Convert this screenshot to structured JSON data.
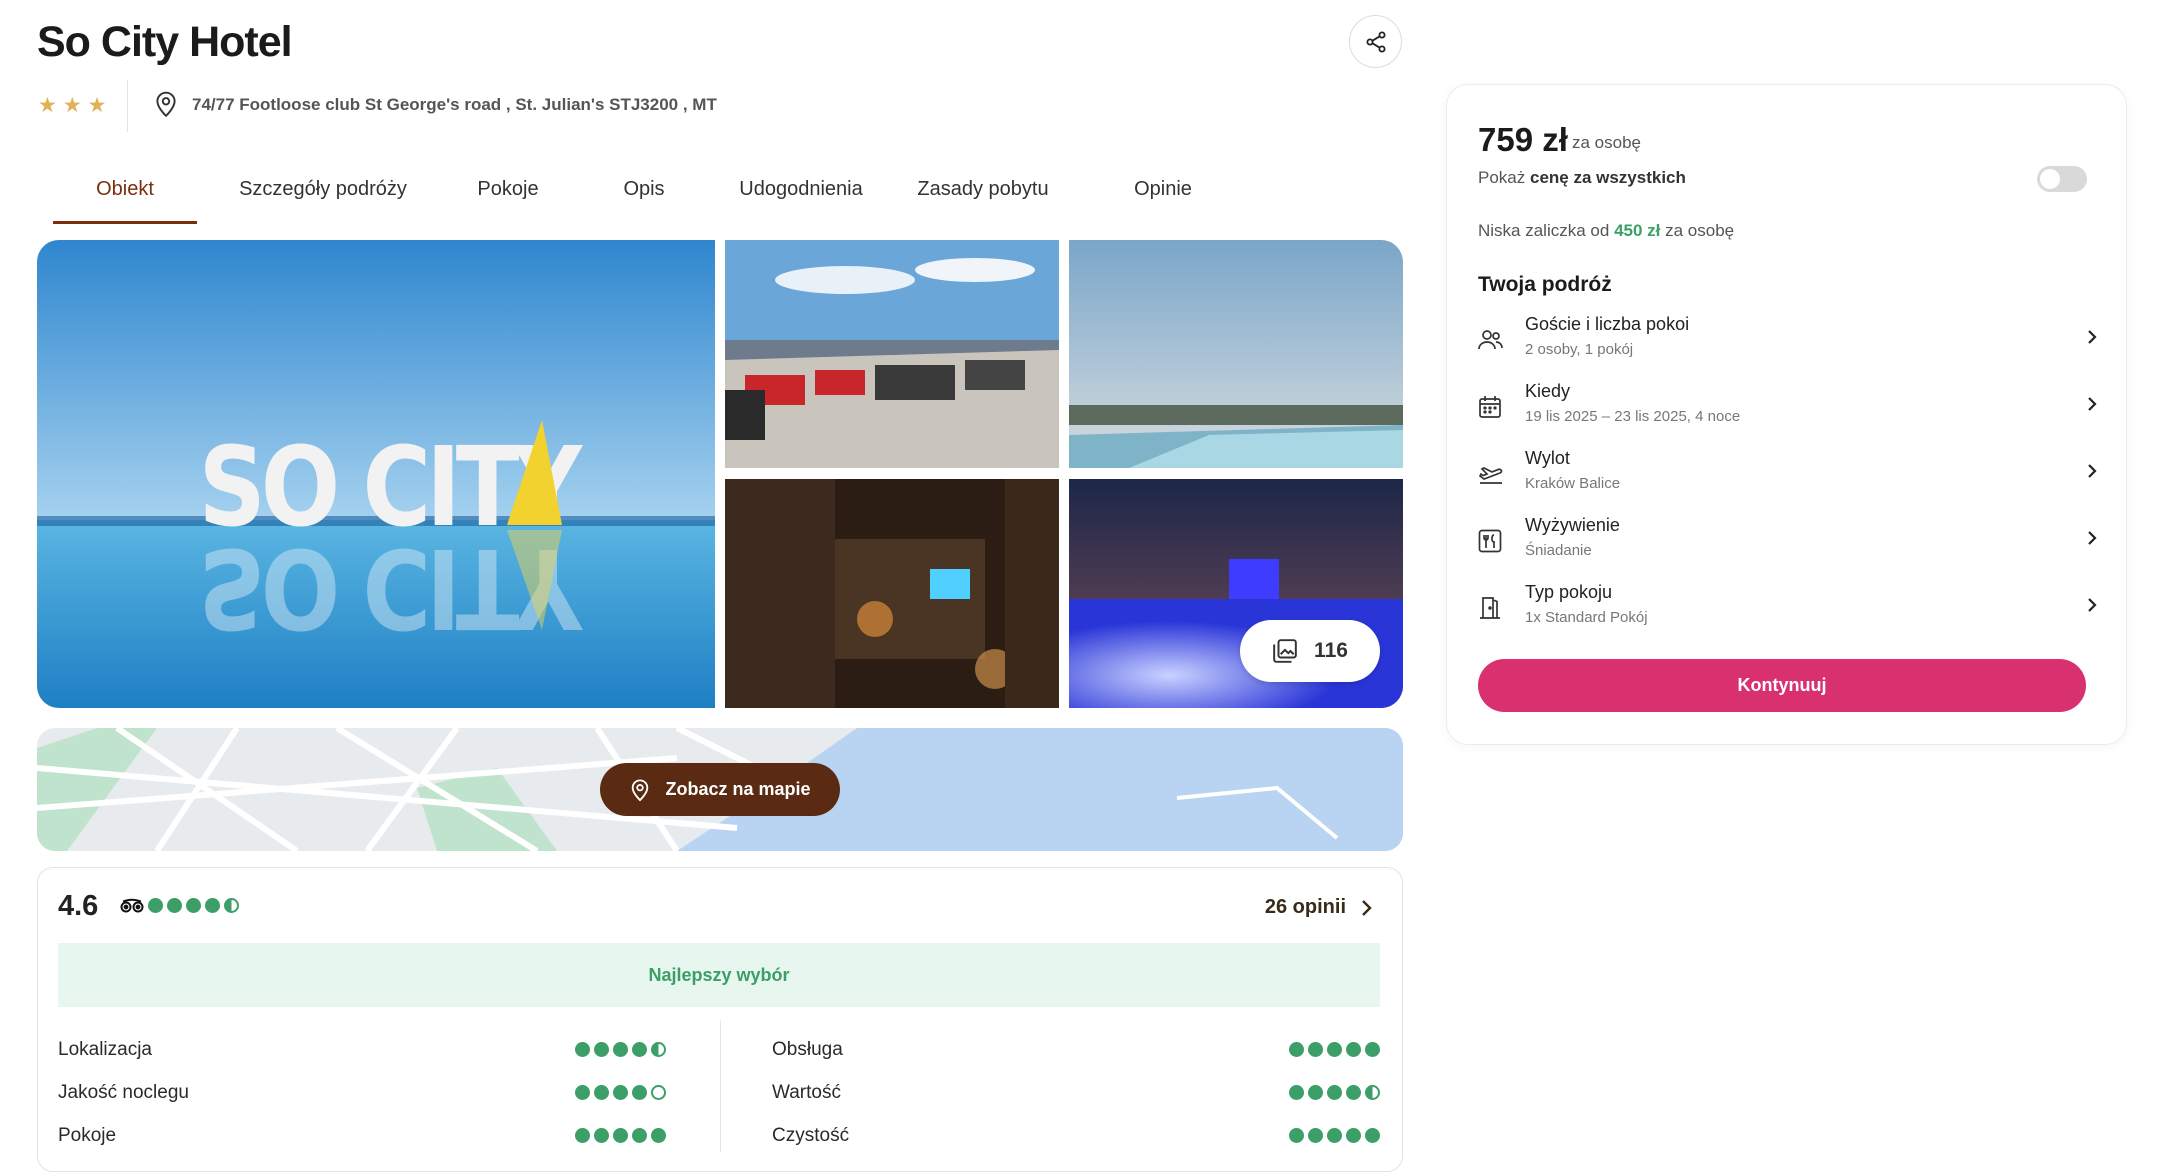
{
  "hotel": {
    "name": "So City Hotel",
    "stars": 3,
    "address": "74/77 Footloose club St George's road , St. Julian's STJ3200 , MT"
  },
  "icons": {
    "share": "share-icon",
    "location": "map-pin-icon",
    "gallery": "gallery-icon",
    "tripadvisor": "tripadvisor-icon",
    "chevron": "chevron-right-icon"
  },
  "tabs": [
    {
      "label": "Obiekt",
      "active": true
    },
    {
      "label": "Szczegóły podróży",
      "active": false
    },
    {
      "label": "Pokoje",
      "active": false
    },
    {
      "label": "Opis",
      "active": false
    },
    {
      "label": "Udogodnienia",
      "active": false
    },
    {
      "label": "Zasady pobytu",
      "active": false
    },
    {
      "label": "Opinie",
      "active": false
    }
  ],
  "gallery": {
    "photo_count": "116"
  },
  "map": {
    "button_label": "Zobacz na mapie"
  },
  "reviews": {
    "score": "4.6",
    "score_dots": 4.5,
    "opinions_label": "26 opinii",
    "badge": "Najlepszy wybór",
    "categories_left": [
      {
        "label": "Lokalizacja",
        "rating": 4.5
      },
      {
        "label": "Jakość noclegu",
        "rating": 4
      },
      {
        "label": "Pokoje",
        "rating": 5
      }
    ],
    "categories_right": [
      {
        "label": "Obsługa",
        "rating": 5
      },
      {
        "label": "Wartość",
        "rating": 4.5
      },
      {
        "label": "Czystość",
        "rating": 5
      }
    ]
  },
  "booking": {
    "price": "759 zł",
    "per_person": "za osobę",
    "show_all_prefix": "Pokaż",
    "show_all_bold": "cenę za wszystkich",
    "deposit_prefix": "Niska zaliczka od",
    "deposit_amount": "450 zł",
    "deposit_suffix": "za osobę",
    "trip_title": "Twoja podróż",
    "trip_rows": [
      {
        "icon": "guests-icon",
        "label": "Goście i liczba pokoi",
        "value": "2 osoby, 1 pokój"
      },
      {
        "icon": "calendar-icon",
        "label": "Kiedy",
        "value": "19 lis 2025 – 23 lis 2025, 4 noce"
      },
      {
        "icon": "plane-departure-icon",
        "label": "Wylot",
        "value": "Kraków Balice"
      },
      {
        "icon": "meal-icon",
        "label": "Wyżywienie",
        "value": "Śniadanie"
      },
      {
        "icon": "door-icon",
        "label": "Typ pokoju",
        "value": "1x Standard Pokój"
      }
    ],
    "continue_label": "Kontynuuj"
  },
  "colors": {
    "brand_brown": "#5a2a12",
    "accent_pink": "#d9306f",
    "rating_green": "#3c9f68",
    "star_gold": "#e0b155"
  }
}
